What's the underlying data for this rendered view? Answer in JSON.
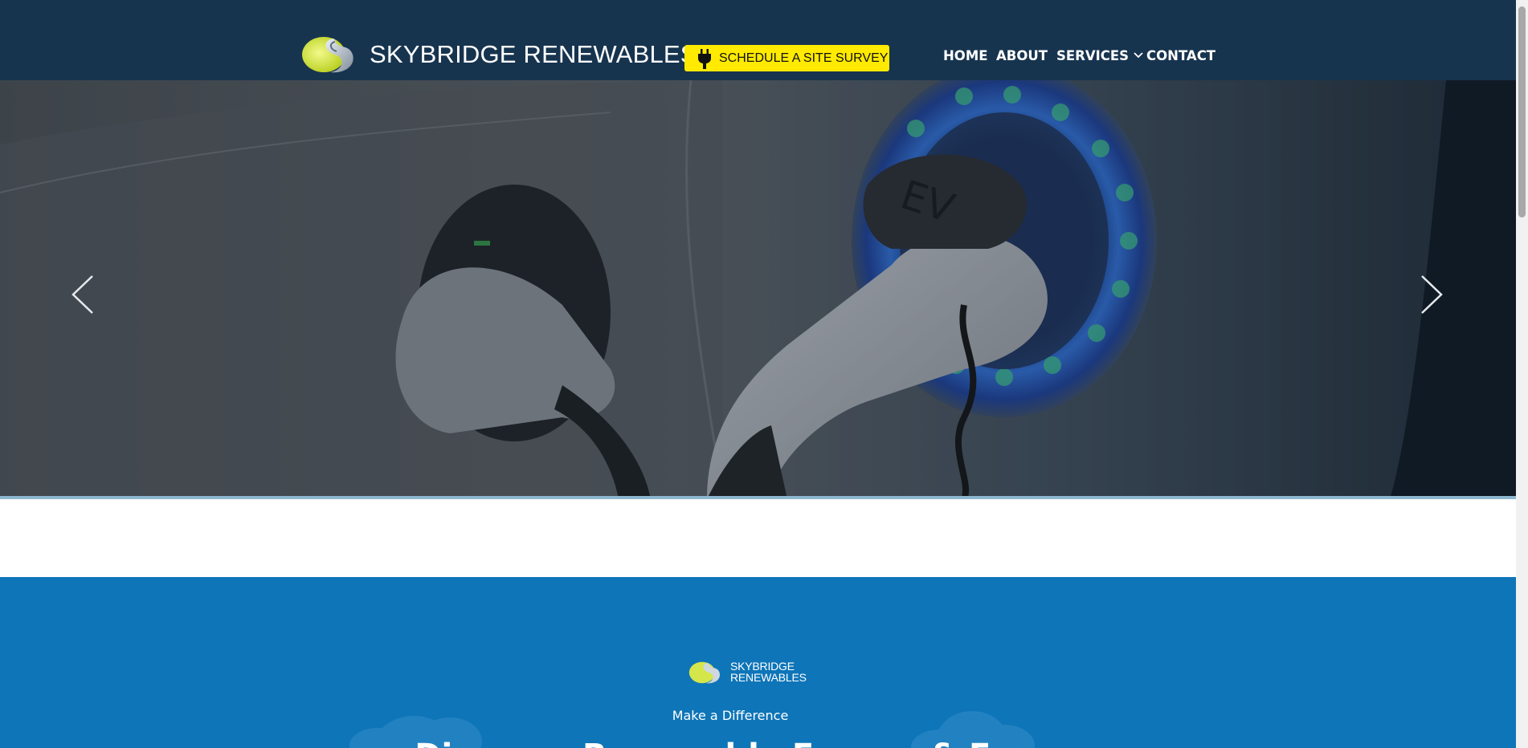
{
  "header": {
    "brand_name": "SKYBRIDGE RENEWABLES",
    "cta_label": "SCHEDULE A SITE SURVEY",
    "cta_icon": "plug-icon",
    "nav": [
      {
        "label": "HOME"
      },
      {
        "label": "ABOUT"
      },
      {
        "label": "SERVICES",
        "has_dropdown": true
      },
      {
        "label": "CONTACT"
      }
    ]
  },
  "hero": {
    "photo_text": "EV",
    "prev_icon": "chevron-left-icon",
    "next_icon": "chevron-right-icon"
  },
  "band": {
    "mini_brand_line1": "SKYBRIDGE",
    "mini_brand_line2": "RENEWABLES",
    "tagline": "Make a Difference",
    "heading": "Discover Renewable Energy & Ev..."
  },
  "colors": {
    "header_bg": "#17344f",
    "cta_bg": "#ffea00",
    "band_bg": "#0e75b8",
    "logo_lime": "#d4e64a"
  }
}
